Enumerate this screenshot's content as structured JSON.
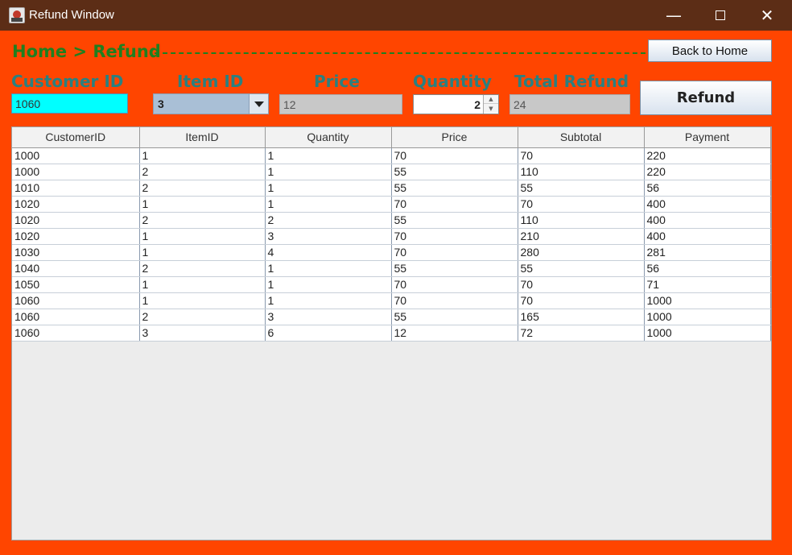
{
  "window": {
    "title": "Refund Window",
    "minimize": "—",
    "close": "✕"
  },
  "breadcrumb": "Home > Refund",
  "buttons": {
    "back_home": "Back to Home",
    "refund": "Refund"
  },
  "labels": {
    "customer_id": "Customer ID",
    "item_id": "Item ID",
    "price": "Price",
    "quantity": "Quantity",
    "total_refund": "Total Refund"
  },
  "fields": {
    "customer_id": "1060",
    "item_id": "3",
    "price": "12",
    "quantity": "2",
    "total_refund": "24"
  },
  "colors": {
    "window_bg": "#ff4500",
    "titlebar": "#5c2d16",
    "breadcrumb": "#1f7f1f",
    "label": "#2a8080",
    "customer_field": "#00ffff"
  },
  "table": {
    "columns": [
      "CustomerID",
      "ItemID",
      "Quantity",
      "Price",
      "Subtotal",
      "Payment"
    ],
    "rows": [
      [
        "1000",
        "1",
        "1",
        "70",
        "70",
        "220"
      ],
      [
        "1000",
        "2",
        "1",
        "55",
        "110",
        "220"
      ],
      [
        "1010",
        "2",
        "1",
        "55",
        "55",
        "56"
      ],
      [
        "1020",
        "1",
        "1",
        "70",
        "70",
        "400"
      ],
      [
        "1020",
        "2",
        "2",
        "55",
        "110",
        "400"
      ],
      [
        "1020",
        "1",
        "3",
        "70",
        "210",
        "400"
      ],
      [
        "1030",
        "1",
        "4",
        "70",
        "280",
        "281"
      ],
      [
        "1040",
        "2",
        "1",
        "55",
        "55",
        "56"
      ],
      [
        "1050",
        "1",
        "1",
        "70",
        "70",
        "71"
      ],
      [
        "1060",
        "1",
        "1",
        "70",
        "70",
        "1000"
      ],
      [
        "1060",
        "2",
        "3",
        "55",
        "165",
        "1000"
      ],
      [
        "1060",
        "3",
        "6",
        "12",
        "72",
        "1000"
      ]
    ]
  }
}
